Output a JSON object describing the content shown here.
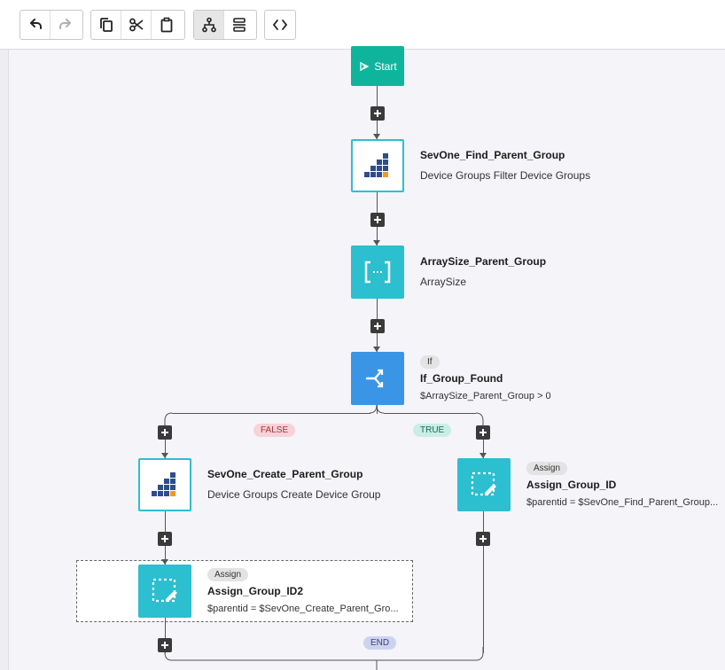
{
  "toolbar": {
    "groups": [
      [
        {
          "icon": "undo-icon"
        },
        {
          "icon": "redo-icon"
        }
      ],
      [
        {
          "icon": "copy-icon"
        },
        {
          "icon": "cut-icon"
        },
        {
          "icon": "paste-icon"
        }
      ],
      [
        {
          "icon": "tree-layout-icon"
        },
        {
          "icon": "list-layout-icon"
        }
      ],
      [
        {
          "icon": "code-icon"
        }
      ]
    ]
  },
  "flow": {
    "start": {
      "label": "Start"
    },
    "find_parent": {
      "title": "SevOne_Find_Parent_Group",
      "subtitle": "Device Groups Filter Device Groups"
    },
    "array_size": {
      "title": "ArraySize_Parent_Group",
      "subtitle": "ArraySize"
    },
    "if_found": {
      "badge": "If",
      "title": "If_Group_Found",
      "subtitle": "$ArraySize_Parent_Group > 0"
    },
    "false_label": "FALSE",
    "true_label": "TRUE",
    "create_parent": {
      "title": "SevOne_Create_Parent_Group",
      "subtitle": "Device Groups Create Device Group"
    },
    "assign_id": {
      "badge": "Assign",
      "title": "Assign_Group_ID",
      "subtitle": "$parentid = $SevOne_Find_Parent_Group..."
    },
    "assign_id2": {
      "badge": "Assign",
      "title": "Assign_Group_ID2",
      "subtitle": "$parentid = $SevOne_Create_Parent_Gro..."
    },
    "end_label": "END"
  },
  "colors": {
    "start": "#0fb49c",
    "teal": "#2bbfd0",
    "if_blue": "#3b95e6",
    "false_pill_bg": "#f8d2d6",
    "false_pill_text": "#a63440",
    "true_pill_bg": "#c9eee4",
    "true_pill_text": "#1c6a58",
    "end_pill_bg": "#cdd3ef",
    "end_pill_text": "#3a4278"
  }
}
